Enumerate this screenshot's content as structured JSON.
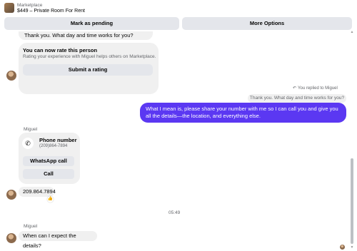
{
  "header": {
    "kicker": "Marketplace",
    "listing_title": "$449 – Private Room For Rent"
  },
  "actions": {
    "mark_pending": "Mark as pending",
    "more_options": "More Options"
  },
  "thread": {
    "messages_top": {
      "partial": "Thank you. What day and time works for you?"
    },
    "rating_card": {
      "title": "You can now rate this person",
      "subtitle": "Rating your experience with Miguel helps others on Marketplace.",
      "button": "Submit a rating"
    },
    "reply_meta": {
      "label": "You replied to Miguel",
      "icon": "reply-arrow-icon",
      "quoted_text": "Thank you. What day and time works for you?"
    },
    "outgoing_message": "What I mean is, please share your number with me so I can call you and give you all the details—the location, and everything else.",
    "phone_block": {
      "sender": "Miguel",
      "title": "Phone number",
      "number": "(209)864-7894",
      "whatsapp_button": "WhatsApp call",
      "call_button": "Call",
      "icon": "phone-icon"
    },
    "number_message": "209.864.7894",
    "reaction": "👍",
    "timestamp": "05:49",
    "last_sender": "Miguel",
    "last_message": "When can I expect the details?"
  },
  "colors": {
    "outgoing_bubble": "#5b38f2",
    "incoming_bubble": "#f0f0f0",
    "button_bg": "#e4e6eb"
  }
}
